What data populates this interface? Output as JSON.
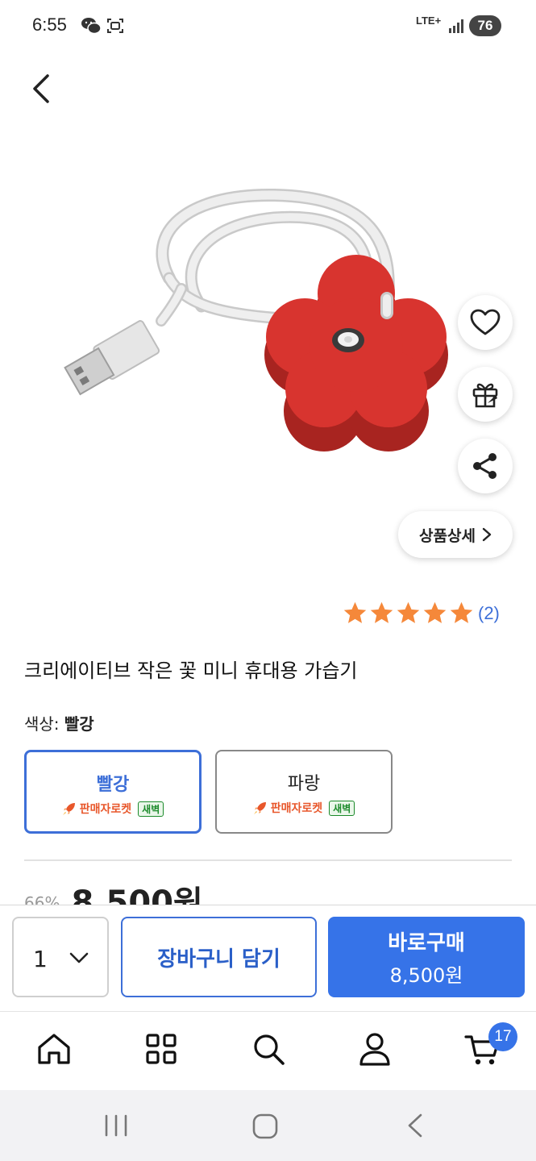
{
  "status_bar": {
    "time": "6:55",
    "network": "LTE+",
    "battery": "76"
  },
  "product": {
    "title": "크리에이티브 작은 꽃 미니 휴대용 가습기",
    "rating_stars": 5,
    "review_count": "(2)",
    "detail_link": "상품상세"
  },
  "options": {
    "label": "색상:",
    "selected_value": "빨강",
    "items": [
      {
        "name": "빨강",
        "badge": "판매자로켓",
        "tag": "새벽"
      },
      {
        "name": "파랑",
        "badge": "판매자로켓",
        "tag": "새벽"
      }
    ]
  },
  "price": {
    "discount": "66%",
    "amount": "8,500원"
  },
  "buy_bar": {
    "quantity": "1",
    "cart_label": "장바구니 담기",
    "buy_label": "바로구매",
    "buy_price": "8,500원"
  },
  "nav": {
    "cart_count": "17"
  },
  "colors": {
    "accent": "#3673e8",
    "accent_text": "#3d6fd8",
    "star": "#f5883a",
    "product_red": "#d8342f",
    "badge_orange": "#e8572b",
    "badge_green": "#1b8a2a"
  }
}
